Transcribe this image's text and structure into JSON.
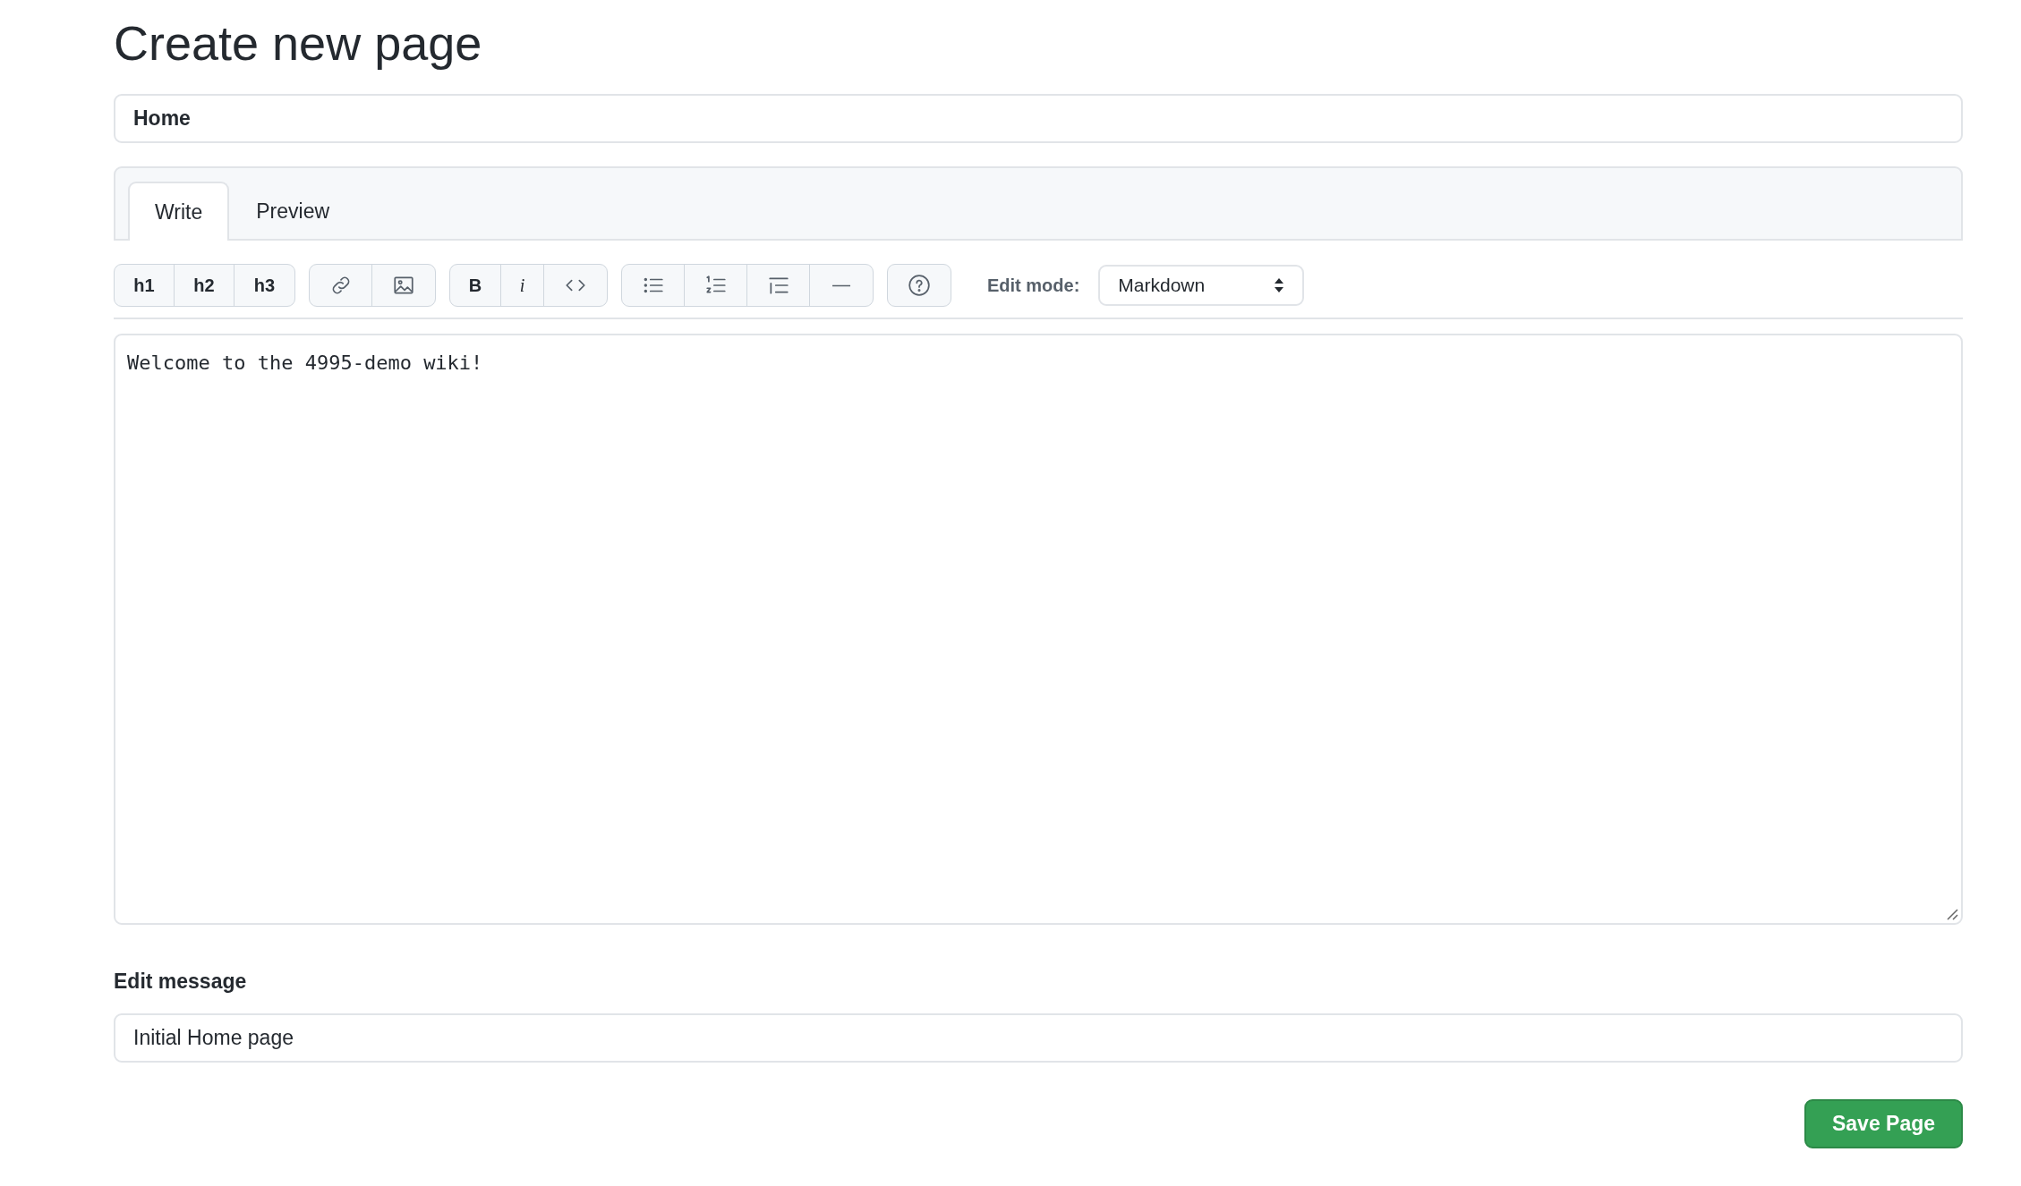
{
  "title": "Create new page",
  "page_title_field": {
    "value": "Home"
  },
  "tabs": [
    {
      "label": "Write",
      "selected": true
    },
    {
      "label": "Preview",
      "selected": false
    }
  ],
  "toolbar": {
    "heading_buttons": [
      "h1",
      "h2",
      "h3"
    ],
    "format_buttons": [
      "B",
      "i"
    ],
    "edit_mode_label": "Edit mode:",
    "edit_mode_value": "Markdown"
  },
  "editor": {
    "value": "Welcome to the 4995-demo wiki!"
  },
  "edit_message": {
    "label": "Edit message",
    "value": "Initial Home page"
  },
  "save_button": "Save Page"
}
